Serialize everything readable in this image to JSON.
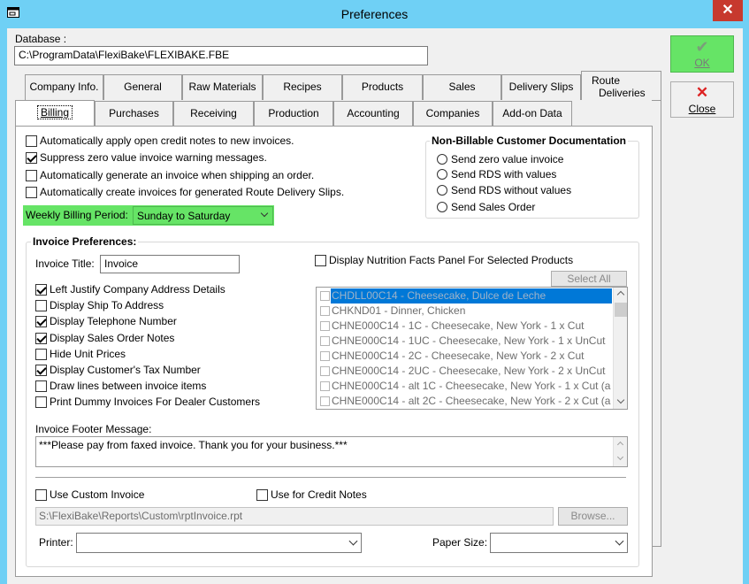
{
  "window": {
    "title": "Preferences"
  },
  "database": {
    "label": "Database :",
    "path": "C:\\ProgramData\\FlexiBake\\FLEXIBAKE.FBE"
  },
  "buttons": {
    "ok": "OK",
    "close": "Close"
  },
  "tabs_row1": [
    "Company Info.",
    "General",
    "Raw Materials",
    "Recipes",
    "Products",
    "Sales",
    "Delivery Slips"
  ],
  "tab_route": {
    "line1": "Route",
    "line2": "Deliveries"
  },
  "tabs_row2": [
    "Billing",
    "Purchases",
    "Receiving",
    "Production",
    "Accounting",
    "Companies",
    "Add-on Data"
  ],
  "billing": {
    "options": [
      {
        "label": "Automatically apply open credit notes to new invoices.",
        "checked": false
      },
      {
        "label": "Suppress zero value invoice warning messages.",
        "checked": true
      },
      {
        "label": "Automatically generate an invoice when shipping an order.",
        "checked": false
      },
      {
        "label": "Automatically create invoices for generated Route Delivery Slips.",
        "checked": false
      }
    ],
    "weekly_label": "Weekly Billing Period:",
    "weekly_value": "Sunday to Saturday",
    "highlight_color": "#66e466"
  },
  "nonbillable": {
    "title": "Non-Billable Customer Documentation",
    "options": [
      "Send zero value invoice",
      "Send RDS with values",
      "Send RDS without values",
      "Send Sales Order"
    ]
  },
  "invoice": {
    "group_title": "Invoice Preferences:",
    "title_label": "Invoice Title:",
    "title_value": "Invoice",
    "options": [
      {
        "label": "Left Justify Company Address Details",
        "checked": true
      },
      {
        "label": "Display Ship To Address",
        "checked": false
      },
      {
        "label": "Display Telephone Number",
        "checked": true
      },
      {
        "label": "Display Sales Order Notes",
        "checked": true
      },
      {
        "label": "Hide Unit Prices",
        "checked": false
      },
      {
        "label": "Display Customer's Tax Number",
        "checked": true
      },
      {
        "label": "Draw lines between invoice items",
        "checked": false
      },
      {
        "label": "Print Dummy Invoices For Dealer Customers",
        "checked": false
      }
    ],
    "nutrition_label": "Display Nutrition Facts Panel For Selected Products",
    "select_all": "Select All",
    "products": [
      "CHDLL00C14 - Cheesecake, Dulce de Leche",
      "CHKND01 - Dinner, Chicken",
      "CHNE000C14 - 1C - Cheesecake, New York - 1 x Cut",
      "CHNE000C14 - 1UC - Cheesecake, New York - 1 x UnCut",
      "CHNE000C14 - 2C - Cheesecake, New York - 2 x Cut",
      "CHNE000C14 - 2UC - Cheesecake, New York - 2 x UnCut",
      "CHNE000C14 - alt 1C - Cheesecake, New York - 1 x Cut (a",
      "CHNE000C14 - alt 2C - Cheesecake, New York - 2 x Cut (a"
    ],
    "footer_label": "Invoice Footer Message:",
    "footer_value": "***Please pay from faxed invoice. Thank you for your business.***",
    "custom_label": "Use Custom Invoice",
    "credit_label": "Use for Credit Notes",
    "custom_path": "S:\\FlexiBake\\Reports\\Custom\\rptInvoice.rpt",
    "browse": "Browse...",
    "printer_label": "Printer:",
    "paper_label": "Paper Size:"
  }
}
